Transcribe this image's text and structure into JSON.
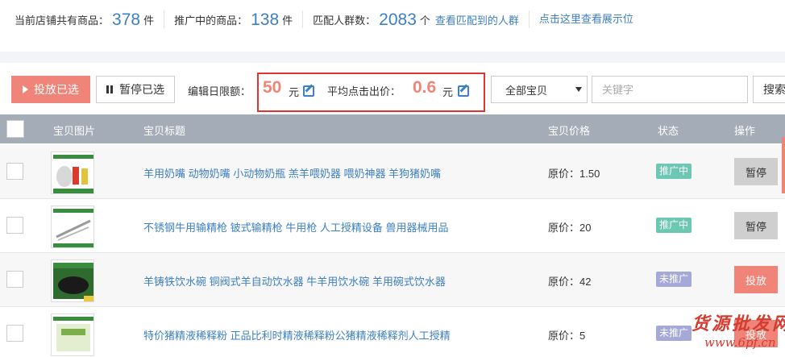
{
  "stats": {
    "total_label": "当前店铺共有商品：",
    "total_value": "378",
    "total_unit": "件",
    "promoting_label": "推广中的商品：",
    "promoting_value": "138",
    "promoting_unit": "件",
    "crowd_label": "匹配人群数：",
    "crowd_value": "2083",
    "crowd_unit": "个",
    "crowd_link": "查看匹配到的人群",
    "display_link": "点击这里查看展示位"
  },
  "toolbar": {
    "start_label": "投放已选",
    "pause_label": "暂停已选",
    "budget_label": "编辑日限额：",
    "budget_value": "50",
    "budget_unit": "元",
    "bid_label": "平均点击出价：",
    "bid_value": "0.6",
    "bid_unit": "元",
    "filter_selected": "全部宝贝",
    "search_placeholder": "关键字",
    "search_label": "搜索"
  },
  "table": {
    "headers": {
      "image": "宝贝图片",
      "title": "宝贝标题",
      "price": "宝贝价格",
      "status": "状态",
      "action": "操作"
    },
    "rows": [
      {
        "title": "羊用奶嘴 动物奶嘴 小动物奶瓶 羔羊喂奶器 喂奶神器 羊狗猪奶嘴",
        "price": "原价：1.50",
        "status": "推广中",
        "action": "暂停"
      },
      {
        "title": "不锈钢牛用输精枪 铍式输精枪 牛用枪 人工授精设备 兽用器械用品",
        "price": "原价：20",
        "status": "推广中",
        "action": "暂停"
      },
      {
        "title": "羊铸铁饮水碗 铜阀式羊自动饮水器 牛羊用饮水碗 羊用碗式饮水器",
        "price": "原价：42",
        "status": "未推广",
        "action": "投放"
      },
      {
        "title": "特价猪精液稀释粉 正品比利时精液稀释粉公猪精液稀释剂人工授精",
        "price": "原价：5",
        "status": "未推广",
        "action": "投放"
      }
    ]
  },
  "watermark": {
    "line1": "货源批发网",
    "line2": "www.6pf.cn"
  },
  "colors": {
    "accent_blue": "#3d7fc1",
    "accent_orange": "#f08478",
    "header_gray": "#a4acb8",
    "highlight_red": "#e0342f",
    "badge_on": "#6cc7b3",
    "badge_off": "#a5a9d8"
  }
}
